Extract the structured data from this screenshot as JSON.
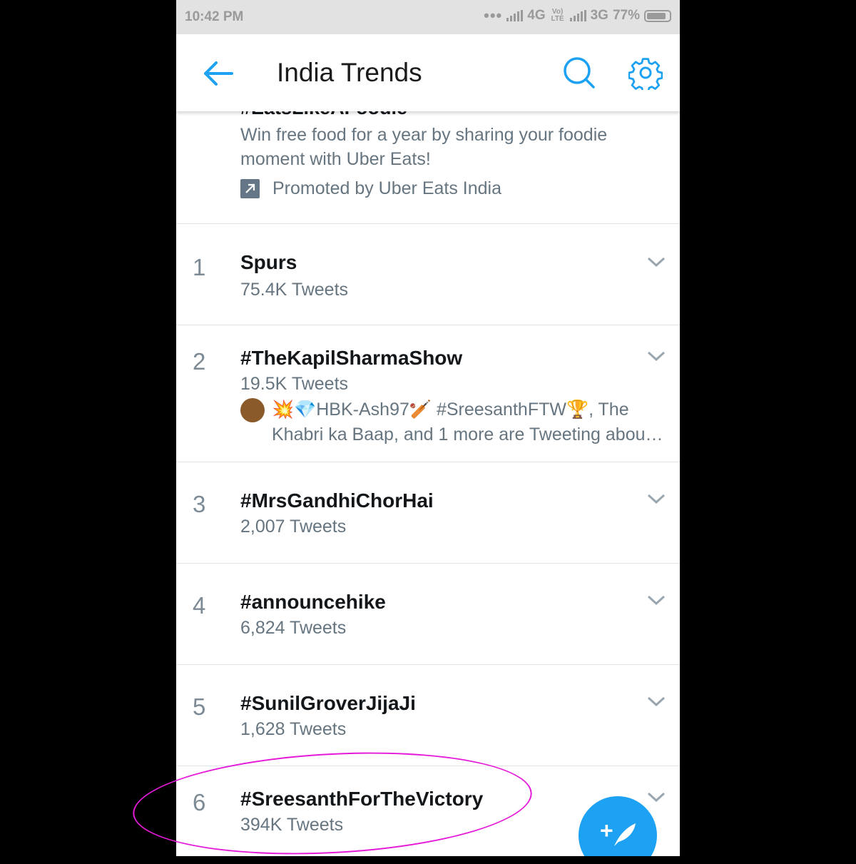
{
  "status_bar": {
    "time": "10:42 PM",
    "network_1": "4G",
    "volte": "Vo) LTE",
    "network_2": "3G",
    "battery": "77%"
  },
  "app_bar": {
    "title": "India Trends",
    "back_icon": "arrow-left-icon",
    "search_icon": "search-icon",
    "settings_icon": "gear-icon"
  },
  "promoted": {
    "title": "#EatsLikeAFoodie",
    "description": "Win free food for a year by sharing your foodie moment with Uber Eats!",
    "promoted_by": "Promoted by Uber Eats India"
  },
  "trends": [
    {
      "rank": "1",
      "name": "Spurs",
      "count": "75.4K Tweets"
    },
    {
      "rank": "2",
      "name": "#TheKapilSharmaShow",
      "count": "19.5K Tweets",
      "context_line1": "💥💎HBK-Ash97🏏 #SreesanthFTW🏆, The",
      "context_line2": "Khabri ka Baap, and 1 more are Tweeting abou…"
    },
    {
      "rank": "3",
      "name": "#MrsGandhiChorHai",
      "count": "2,007 Tweets"
    },
    {
      "rank": "4",
      "name": "#announcehike",
      "count": "6,824 Tweets"
    },
    {
      "rank": "5",
      "name": "#SunilGroverJijaJi",
      "count": "1,628 Tweets"
    },
    {
      "rank": "6",
      "name": "#SreesanthForTheVictory",
      "count": "394K Tweets"
    }
  ],
  "fab": {
    "label": "+",
    "icon": "feather-icon"
  },
  "colors": {
    "accent": "#1da1f2",
    "highlight": "#e41ad8"
  }
}
